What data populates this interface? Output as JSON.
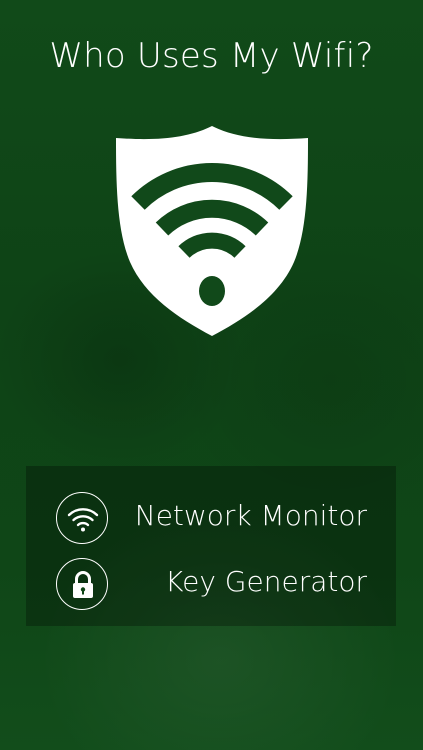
{
  "app": {
    "title": "Who Uses My Wifi?"
  },
  "logo": {
    "icon": "shield-wifi-icon",
    "shield_color": "#ffffff",
    "emblem_color": "#11491a"
  },
  "menu": {
    "items": [
      {
        "label": "Network Monitor",
        "icon": "wifi-icon"
      },
      {
        "label": "Key Generator",
        "icon": "lock-icon"
      }
    ]
  },
  "theme": {
    "background": "#0f4617",
    "text": "#ffffff"
  }
}
